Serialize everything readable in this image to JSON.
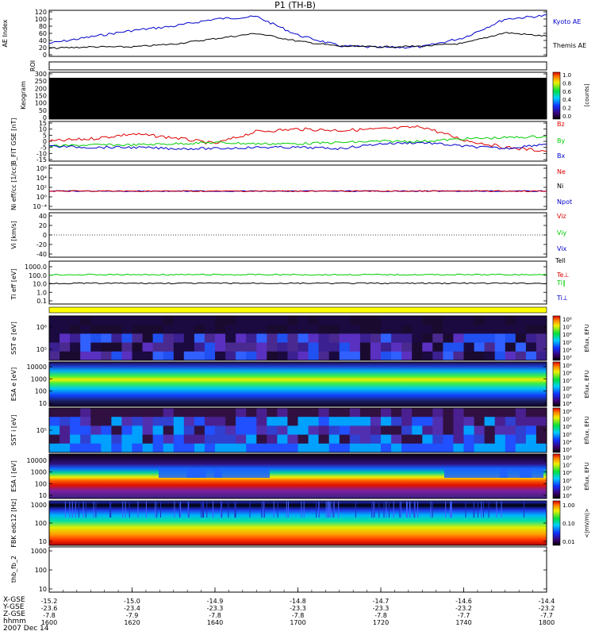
{
  "title": "P1 (TH-B)",
  "time_axis": {
    "hhmm": [
      "1600",
      "1620",
      "1640",
      "1700",
      "1720",
      "1740",
      "1800"
    ],
    "date": "2007 Dec 14",
    "rows": [
      {
        "name": "X-GSE",
        "values": [
          "-15.2",
          "-15.0",
          "-14.9",
          "-14.8",
          "-14.7",
          "-14.6",
          "-14.4"
        ]
      },
      {
        "name": "Y-GSE",
        "values": [
          "-23.6",
          "-23.4",
          "-23.3",
          "-23.3",
          "-23.3",
          "-23.2",
          "-23.2"
        ]
      },
      {
        "name": "Z-GSE",
        "values": [
          "-7.8",
          "-7.9",
          "-7.8",
          "-7.8",
          "-7.8",
          "-7.7",
          "-7.7"
        ]
      },
      {
        "name": "hhmm",
        "values": [
          "1600",
          "1620",
          "1640",
          "1700",
          "1720",
          "1740",
          "1800"
        ]
      }
    ]
  },
  "panels": {
    "ae": {
      "ylabel": "AE Index",
      "ticks": [
        "0",
        "20",
        "40",
        "60",
        "80",
        "100",
        "120"
      ],
      "legend": [
        "Kyoto AE",
        "Themis AE"
      ]
    },
    "roi": {
      "ylabel": "ROI"
    },
    "keogram": {
      "ylabel": "Keogram",
      "ticks": [
        "0",
        "50",
        "100",
        "150",
        "200",
        "250",
        "300"
      ],
      "cbar_ticks": [
        "0.0",
        "0.2",
        "0.4",
        "0.6",
        "0.8",
        "1.0"
      ],
      "cbar_label": "[counts]"
    },
    "bfit": {
      "ylabel": "B_FIT GSE [nT]",
      "ticks": [
        "-15",
        "-10",
        "-5",
        "0",
        "5",
        "10",
        "15"
      ],
      "legend": [
        "Bz",
        "By",
        "Bx"
      ]
    },
    "ni": {
      "ylabel": "Ni eff/cc [1/cc]",
      "ticks": [
        "10⁻⁴",
        "10⁰",
        "10²",
        "10⁴",
        "10⁶"
      ],
      "legend": [
        "Ne",
        "Ni",
        "Npot"
      ]
    },
    "vi": {
      "ylabel": "Vi [km/s]",
      "ticks": [
        "-40",
        "-20",
        "0",
        "20",
        "40"
      ],
      "legend": [
        "Viz",
        "Viy",
        "Vix"
      ]
    },
    "ti": {
      "ylabel": "Ti eff [eV]",
      "ticks": [
        "0.1",
        "1.0",
        "10.0",
        "100.0",
        "1000.0"
      ],
      "legend": [
        "Tell",
        "Te⊥",
        "Ti∥",
        "Ti⊥"
      ]
    },
    "sst_e": {
      "ylabel": "SST e [eV]",
      "ticks": [
        "10⁵",
        "10⁶"
      ],
      "cbar_ticks": [
        "10⁸",
        "10⁷",
        "10⁶",
        "10⁵",
        "10⁴",
        "10³"
      ],
      "cbar_label": "Eflux, EFU"
    },
    "esa_e": {
      "ylabel": "ESA e [eV]",
      "ticks": [
        "10",
        "100",
        "1000",
        "10000"
      ],
      "cbar_ticks": [
        "10⁹",
        "10⁸",
        "10⁷",
        "10⁶",
        "10⁵",
        "10⁴"
      ],
      "cbar_label": "Eflux, EFU"
    },
    "sst_i": {
      "ylabel": "SST i [eV]",
      "ticks": [
        "10⁵"
      ],
      "cbar_ticks": [
        "10⁸",
        "10⁷",
        "10⁶",
        "10⁵",
        "10⁴",
        "10³"
      ],
      "cbar_label": "Eflux, EFU"
    },
    "esa_i": {
      "ylabel": "ESA i [eV]",
      "ticks": [
        "10",
        "100",
        "1000",
        "10000"
      ],
      "cbar_ticks": [
        "10⁸",
        "10⁷",
        "10⁶",
        "10⁵",
        "10⁴",
        "10³"
      ],
      "cbar_label": "Eflux, EFU"
    },
    "fbk": {
      "ylabel": "FBK edc12 [Hz]",
      "ticks": [
        "10",
        "100",
        "1000"
      ],
      "cbar_ticks": [
        "1.00",
        "0.10",
        "0.01"
      ],
      "cbar_label": "<|mV/m|>"
    },
    "fb2": {
      "ylabel": "thb_fb_2",
      "ticks": [
        "10",
        "100",
        "1000"
      ]
    }
  },
  "chart_data": {
    "type": "line",
    "title": "P1 (TH-B)",
    "x_unit": "UT hhmm",
    "x": [
      "1600",
      "1610",
      "1620",
      "1630",
      "1640",
      "1650",
      "1700",
      "1710",
      "1720",
      "1730",
      "1740",
      "1750",
      "1800"
    ],
    "panels": [
      {
        "name": "AE Index",
        "ylim": [
          0,
          120
        ],
        "series": [
          {
            "name": "Kyoto AE",
            "values": [
              32,
              50,
              68,
              80,
              100,
              107,
              55,
              25,
              20,
              22,
              48,
              100,
              110
            ]
          },
          {
            "name": "Themis AE",
            "values": [
              18,
              22,
              22,
              30,
              45,
              60,
              38,
              24,
              22,
              24,
              32,
              62,
              52
            ]
          }
        ]
      },
      {
        "name": "B_FIT GSE",
        "ylim": [
          -15,
          15
        ],
        "series": [
          {
            "name": "Bz",
            "values": [
              0,
              2,
              6,
              3,
              -2,
              8,
              10,
              9,
              10,
              12,
              1,
              -5,
              -8
            ]
          },
          {
            "name": "By",
            "values": [
              -4,
              -3,
              -3,
              -2,
              -1,
              -2,
              -2,
              -1,
              0,
              0,
              2,
              3,
              4
            ]
          },
          {
            "name": "Bx",
            "values": [
              -4,
              -5,
              -5,
              -6,
              -6,
              -5,
              -5,
              -6,
              -2,
              -1,
              -4,
              -6,
              -2
            ]
          }
        ]
      },
      {
        "name": "Ni",
        "ylog": true,
        "ylim": [
          0.0001,
          1000000
        ],
        "series": [
          {
            "name": "Ni",
            "values": [
              1,
              1,
              1,
              1,
              1,
              1,
              1,
              1,
              1,
              1,
              1,
              1,
              1
            ]
          }
        ]
      },
      {
        "name": "Ti",
        "ylog": true,
        "ylim": [
          0.1,
          3000
        ],
        "series": [
          {
            "name": "Te⊥",
            "values": [
              300,
              300,
              300,
              300,
              300,
              300,
              300,
              300,
              300,
              300,
              300,
              300,
              300
            ]
          },
          {
            "name": "Ti∥",
            "values": [
              25,
              25,
              25,
              25,
              25,
              25,
              25,
              25,
              25,
              25,
              25,
              25,
              25
            ]
          }
        ]
      }
    ]
  },
  "colors": {
    "kyoto_ae": "#0000cc",
    "themis_ae": "#000000",
    "bz": "#dd0000",
    "by": "#00cc00",
    "bx": "#0000cc",
    "ni_red": "#dd0000",
    "ni_blue": "#0000cc",
    "te_perp": "#00cc00",
    "ti_par": "#000000",
    "band": "#ffff00"
  }
}
